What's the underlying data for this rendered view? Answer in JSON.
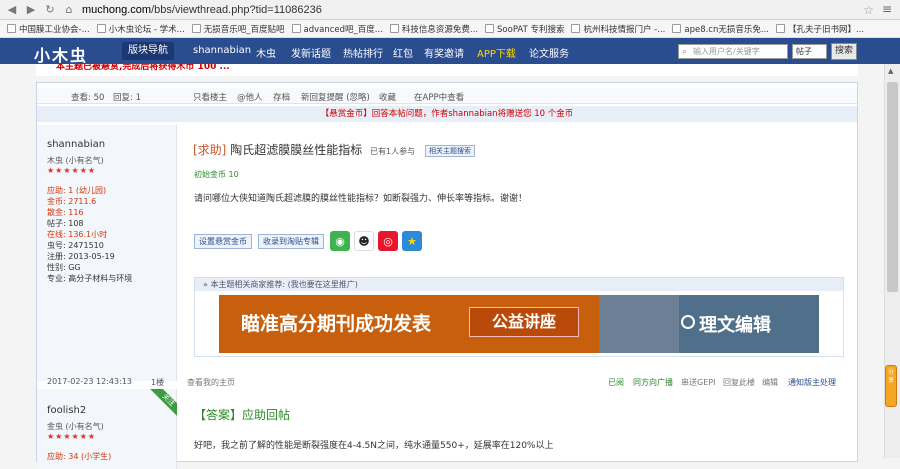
{
  "browser": {
    "url_host": "muchong.com",
    "url_path": "/bbs/viewthread.php?tid=11086236",
    "bookmarks": [
      "中国膜工业协会-...",
      "小木虫论坛 - 学术...",
      "无损音乐吧_百度贴吧",
      "advanced吧_百度...",
      "科技信息资源免费...",
      "SooPAT 专利搜索",
      "杭州科技情报门户 -...",
      "ape8.cn无损音乐免...",
      "【孔夫子旧书网】..."
    ]
  },
  "nav": {
    "logo": "小木虫",
    "items": [
      "版块导航",
      "shannabian",
      "木虫",
      "发新话题",
      "热帖排行",
      "红包",
      "有奖邀请",
      "APP下载",
      "论文服务"
    ],
    "search_placeholder": "输入用户名/关键字",
    "search_select": "帖子",
    "search_button": "搜索"
  },
  "notice": "本主题已被悬赏,完成后将获得木币 100 ...",
  "thread": {
    "topbar": {
      "views": "查看: 50",
      "replies": "回复: 1",
      "actions": [
        "只看楼主",
        "@他人",
        "存档",
        "新回复提醒 (忽略)",
        "收藏",
        "在APP中查看"
      ]
    },
    "reward_notice": "【悬赏金币】回答本帖问题，作者shannabian将赠送您 10 个金币",
    "author": {
      "name": "shannabian",
      "rank": "木虫 (小有名气)",
      "stars": "★★★★★★",
      "stats": [
        "应助: 1 (幼儿园)",
        "金币: 2711.6",
        "散金: 116",
        "帖子: 108",
        "在线: 136.1小时",
        "虫号: 2471510",
        "注册: 2013-05-19",
        "性别: GG",
        "专业: 高分子材料与环境"
      ]
    },
    "post": {
      "tag": "[求助]",
      "title": "陶氏超滤膜膜丝性能指标",
      "participants": "已有1人参与",
      "related_search": "相关主题搜索",
      "initial_coins": "初始金币 10",
      "body": "请问哪位大侠知道陶氏超滤膜的膜丝性能指标？如断裂强力、伸长率等指标。谢谢！",
      "btn_reward": "设置悬赏金币",
      "btn_fav": "收录到淘贴专辑",
      "share_icons": [
        "wechat-icon",
        "qq-icon",
        "weibo-icon",
        "qzone-icon"
      ],
      "ad_header": "» 本主题相关商家推荐: (我也要在这里推广)",
      "ad_text1": "瞄准高分期刊成功发表",
      "ad_text2": "公益讲座",
      "ad_brand": "理文编辑",
      "date": "2017-02-23 12:43:13",
      "floor": "1楼",
      "view_home": "查看我的主页",
      "footer_actions": [
        "已阅",
        "同方向广播",
        "串送GEPI",
        "回复此楼",
        "编辑",
        "通知版主处理"
      ]
    },
    "reply": {
      "author": "foolish2",
      "rank": "金虫 (小有名气)",
      "stars": "★★★★★★",
      "stat": "应助: 34 (小学生)",
      "ribbon": "关注",
      "tag": "【答案】应助回帖",
      "body": "好吧，我之前了解的性能是断裂强度在4-4.5N之间，纯水通量550+，延展率在120%以上"
    }
  },
  "float_label": "分享"
}
